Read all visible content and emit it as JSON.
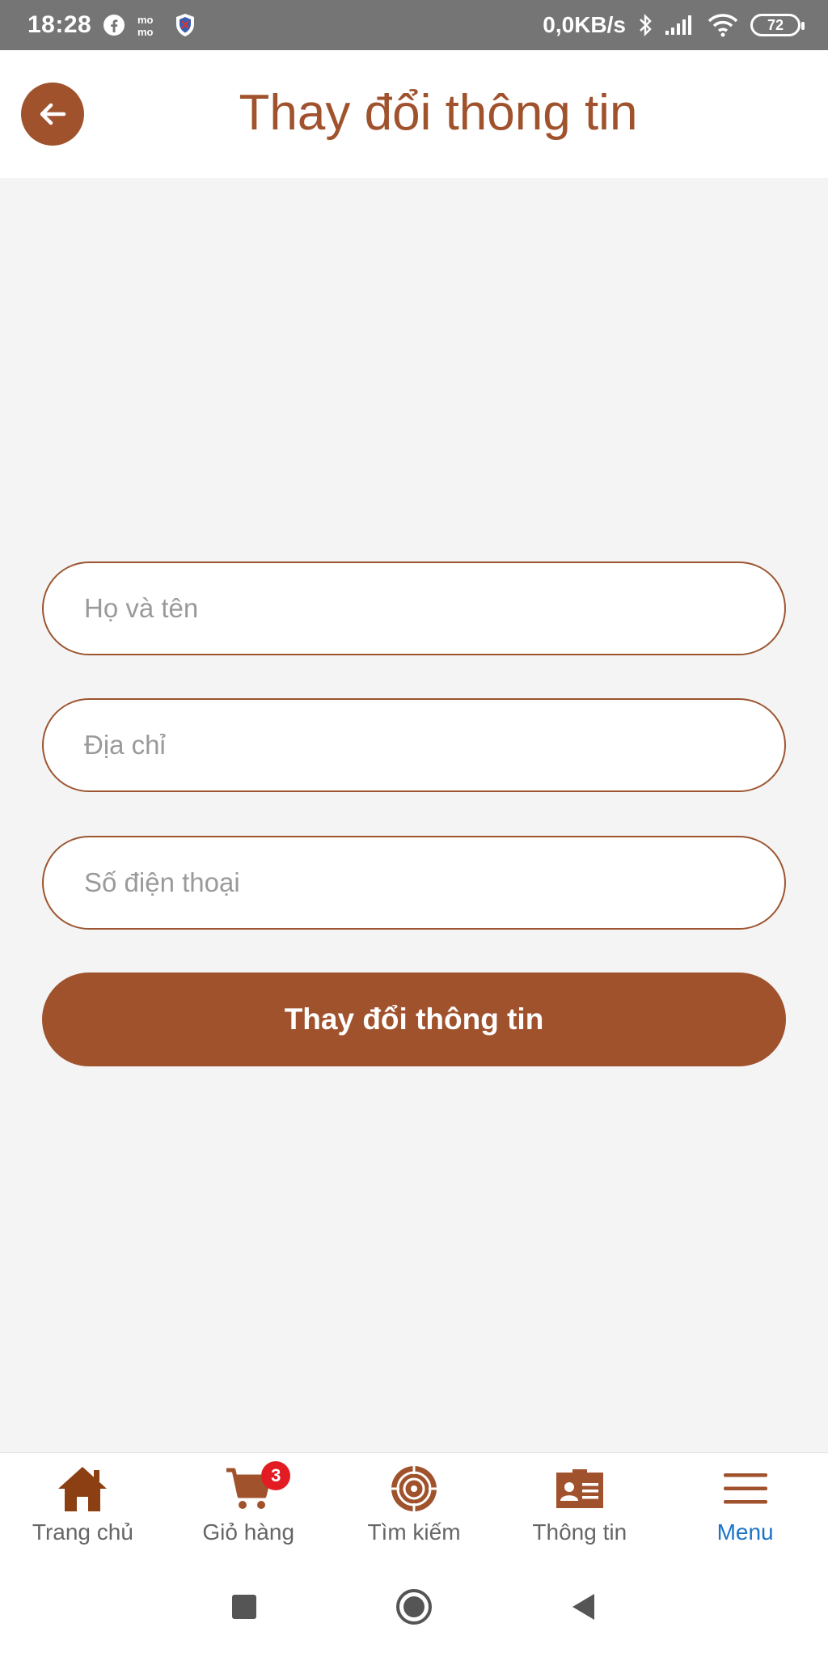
{
  "status_bar": {
    "time": "18:28",
    "network_speed": "0,0KB/s",
    "battery": "72",
    "icons": [
      "facebook-icon",
      "momo-icon",
      "shield-icon",
      "bluetooth-icon",
      "signal-icon",
      "wifi-icon",
      "battery-icon"
    ]
  },
  "header": {
    "title": "Thay đổi thông tin",
    "back_icon": "arrow-left-icon"
  },
  "form": {
    "name": {
      "placeholder": "Họ và tên",
      "value": ""
    },
    "address": {
      "placeholder": "Địa chỉ",
      "value": ""
    },
    "phone": {
      "placeholder": "Số điện thoại",
      "value": ""
    },
    "submit_label": "Thay đổi thông tin"
  },
  "bottom_nav": {
    "items": [
      {
        "label": "Trang chủ",
        "icon": "home-icon"
      },
      {
        "label": "Giỏ hàng",
        "icon": "cart-icon",
        "badge": "3"
      },
      {
        "label": "Tìm kiếm",
        "icon": "target-icon"
      },
      {
        "label": "Thông tin",
        "icon": "id-card-icon"
      },
      {
        "label": "Menu",
        "icon": "hamburger-menu-icon",
        "active": true
      }
    ]
  },
  "colors": {
    "accent": "#a0522d",
    "active_nav": "#1a73c9",
    "badge": "#e31b23",
    "status_bar": "#757575",
    "background": "#f4f4f4"
  }
}
